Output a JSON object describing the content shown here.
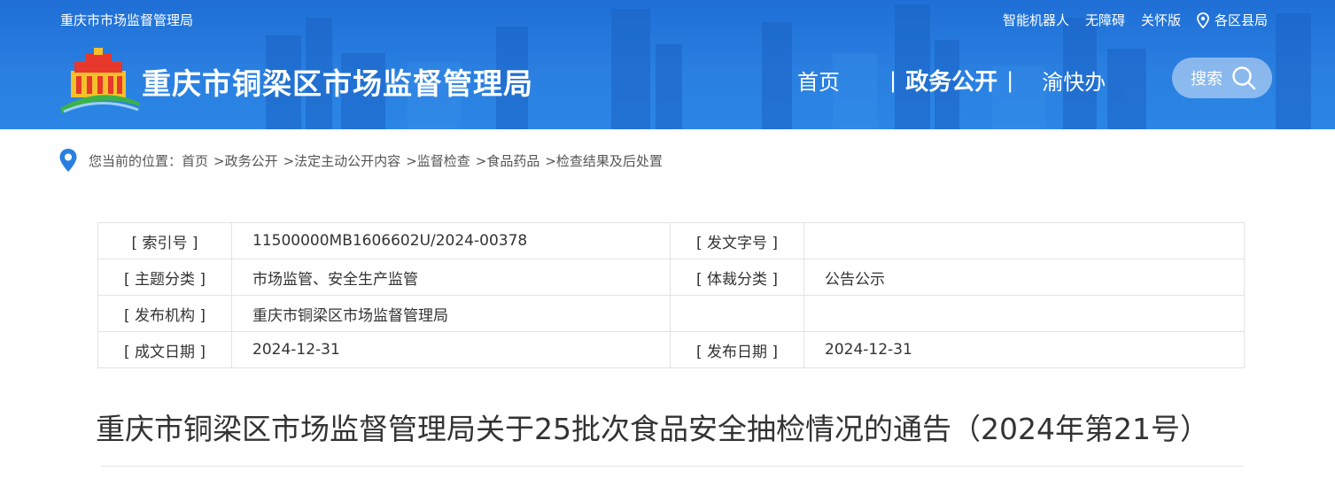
{
  "header": {
    "top_left": "重庆市市场监督管理局",
    "top_links": [
      "智能机器人",
      "无障碍",
      "关怀版"
    ],
    "region_label": "各区县局",
    "site_title": "重庆市铜梁区市场监督管理局",
    "nav": [
      "首页",
      "政务公开",
      "渝快办"
    ],
    "search_label": "搜索"
  },
  "breadcrumb": {
    "prefix": "您当前的位置：",
    "items": [
      "首页",
      ">政务公开",
      ">法定主动公开内容",
      ">监督检查",
      ">食品药品",
      ">检查结果及后处置"
    ]
  },
  "meta": {
    "rows": [
      {
        "l1": "[ 索引号 ]",
        "v1": "11500000MB1606602U/2024-00378",
        "l2": "[ 发文字号 ]",
        "v2": ""
      },
      {
        "l1": "[ 主题分类 ]",
        "v1": "市场监管、安全生产监管",
        "l2": "[ 体裁分类 ]",
        "v2": "公告公示"
      },
      {
        "l1": "[ 发布机构 ]",
        "v1": "重庆市铜梁区市场监督管理局",
        "l2": "",
        "v2": ""
      },
      {
        "l1": "[ 成文日期 ]",
        "v1": "2024-12-31",
        "l2": "[ 发布日期 ]",
        "v2": "2024-12-31"
      }
    ]
  },
  "doc_title": "重庆市铜梁区市场监督管理局关于25批次食品安全抽检情况的通告（2024年第21号）",
  "colors": {
    "header_blue": "#2a7fe0",
    "text": "#333333"
  }
}
